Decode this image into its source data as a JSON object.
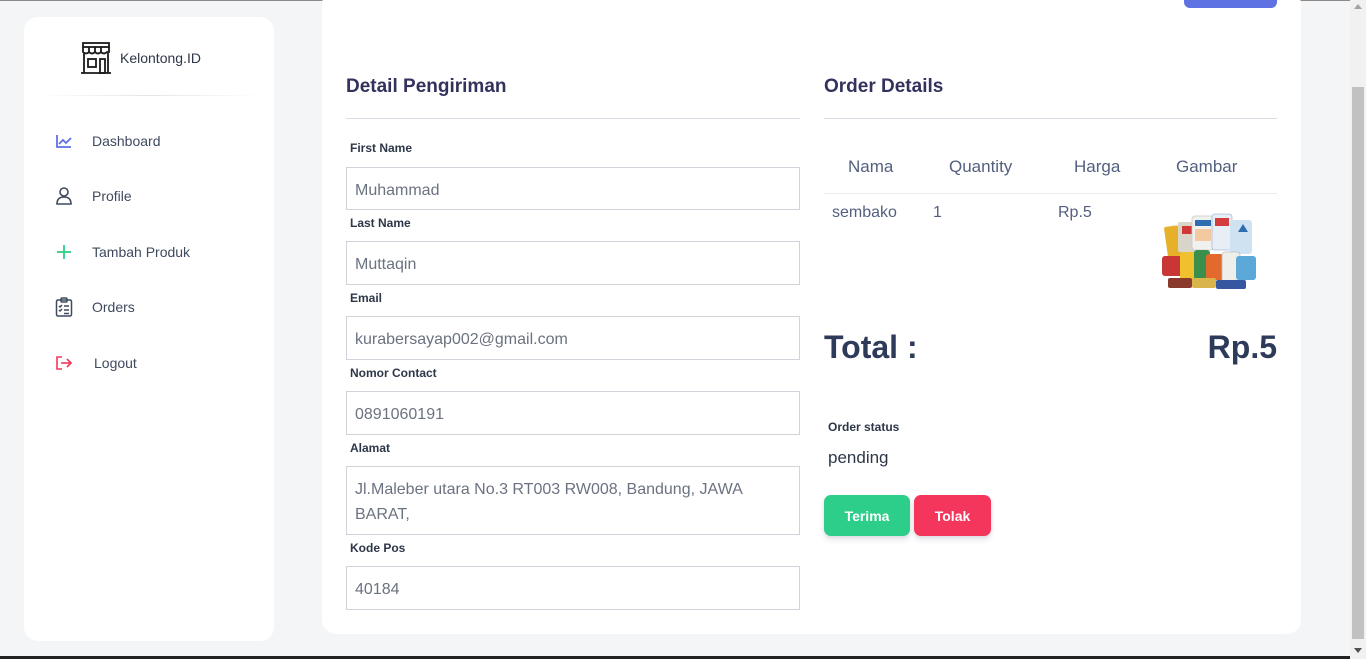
{
  "brand": {
    "name": "Kelontong.ID",
    "icon": "store-icon"
  },
  "sidebar": {
    "items": [
      {
        "label": "Dashboard",
        "icon": "chart-line-icon",
        "color": "#5e72e4"
      },
      {
        "label": "Profile",
        "icon": "user-icon",
        "color": "#3f4a5e"
      },
      {
        "label": "Tambah Produk",
        "icon": "plus-icon",
        "color": "#2dce89"
      },
      {
        "label": "Orders",
        "icon": "clipboard-list-icon",
        "color": "#3f4a5e"
      },
      {
        "label": "Logout",
        "icon": "logout-icon",
        "color": "#f5365c"
      }
    ]
  },
  "shipping": {
    "title": "Detail Pengiriman",
    "first_name_label": "First Name",
    "first_name_value": "Muhammad",
    "last_name_label": "Last Name",
    "last_name_value": "Muttaqin",
    "email_label": "Email",
    "email_value": "kurabersayap002@gmail.com",
    "contact_label": "Nomor Contact",
    "contact_value": "0891060191",
    "address_label": "Alamat",
    "address_value": "Jl.Maleber utara No.3 RT003 RW008, Bandung, JAWA BARAT,",
    "postal_label": "Kode Pos",
    "postal_value": "40184"
  },
  "order": {
    "title": "Order Details",
    "columns": [
      "Nama",
      "Quantity",
      "Harga",
      "Gambar"
    ],
    "rows": [
      {
        "nama": "sembako",
        "quantity": "1",
        "harga": "Rp.5",
        "gambar": "groceries-image"
      }
    ],
    "total_label": "Total :",
    "total_value": "Rp.5",
    "status_label": "Order status",
    "status_value": "pending",
    "accept_label": "Terima",
    "reject_label": "Tolak"
  },
  "colors": {
    "primary": "#5e72e4",
    "success": "#2dce89",
    "danger": "#f5365c",
    "heading": "#32325d"
  }
}
